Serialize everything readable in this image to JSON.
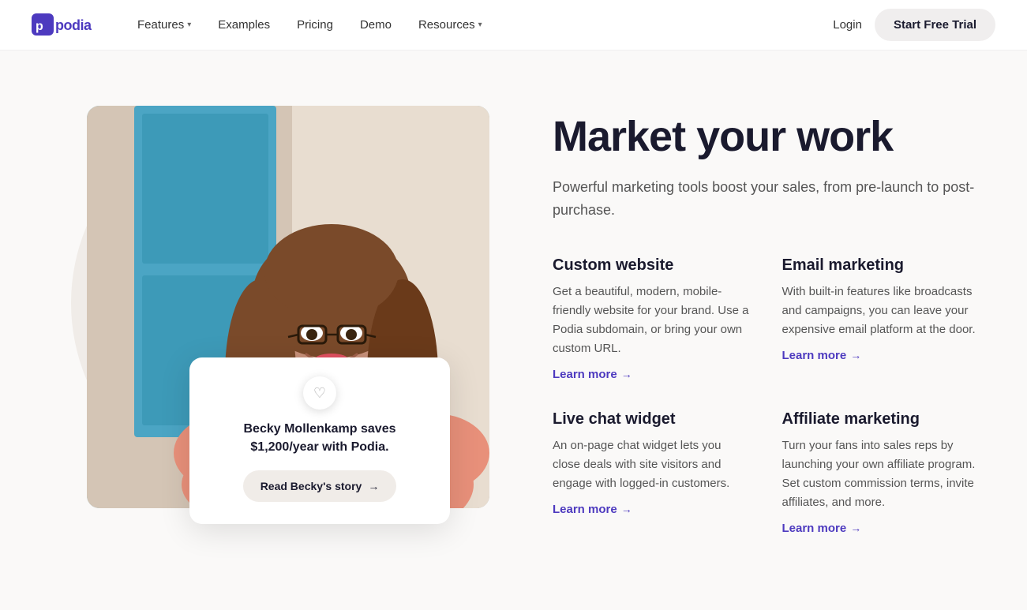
{
  "nav": {
    "logo": "podia",
    "links": [
      {
        "label": "Features",
        "hasDropdown": true
      },
      {
        "label": "Examples",
        "hasDropdown": false
      },
      {
        "label": "Pricing",
        "hasDropdown": false
      },
      {
        "label": "Demo",
        "hasDropdown": false
      },
      {
        "label": "Resources",
        "hasDropdown": true
      }
    ],
    "login_label": "Login",
    "cta_label": "Start Free Trial"
  },
  "hero": {
    "heading": "Market your work",
    "subtitle": "Powerful marketing tools boost your sales, from pre-launch to post-purchase.",
    "person_card": {
      "testimonial": "Becky Mollenkamp saves $1,200/year with Podia.",
      "cta_label": "Read Becky's story",
      "cta_arrow": "→",
      "heart_icon": "♡"
    }
  },
  "features": [
    {
      "id": "custom-website",
      "title": "Custom website",
      "description": "Get a beautiful, modern, mobile-friendly website for your brand. Use a Podia subdomain, or bring your own custom URL.",
      "learn_more": "Learn more",
      "arrow": "→"
    },
    {
      "id": "email-marketing",
      "title": "Email marketing",
      "description": "With built-in features like broadcasts and campaigns, you can leave your expensive email platform at the door.",
      "learn_more": "Learn more",
      "arrow": "→"
    },
    {
      "id": "live-chat-widget",
      "title": "Live chat widget",
      "description": "An on-page chat widget lets you close deals with site visitors and engage with logged-in customers.",
      "learn_more": "Learn more",
      "arrow": "→"
    },
    {
      "id": "affiliate-marketing",
      "title": "Affiliate marketing",
      "description": "Turn your fans into sales reps by launching your own affiliate program. Set custom commission terms, invite affiliates, and more.",
      "learn_more": "Learn more",
      "arrow": "→"
    }
  ],
  "colors": {
    "accent": "#4d3abf",
    "bg_light": "#faf9f8",
    "circle_bg": "#f0ece8"
  }
}
